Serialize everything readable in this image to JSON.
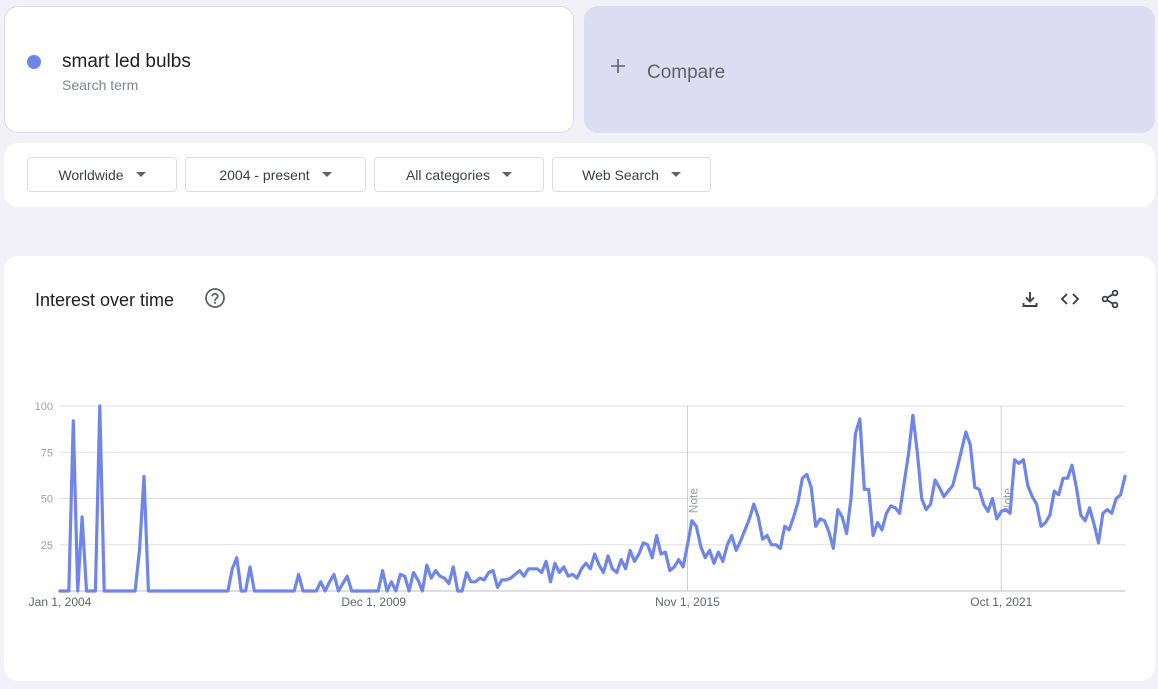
{
  "search_term": {
    "name": "smart led bulbs",
    "subtitle": "Search term",
    "color": "#6f86e8"
  },
  "compare": {
    "label": "Compare",
    "icon": "plus-icon"
  },
  "filters": [
    {
      "label": "Worldwide"
    },
    {
      "label": "2004 - present"
    },
    {
      "label": "All categories"
    },
    {
      "label": "Web Search"
    }
  ],
  "chart_card": {
    "title": "Interest over time",
    "icons": [
      "help-icon",
      "download-icon",
      "embed-icon",
      "share-icon"
    ]
  },
  "chart_data": {
    "type": "line",
    "title": "",
    "xlabel": "",
    "ylabel": "",
    "ylim": [
      0,
      100
    ],
    "yticks": [
      25,
      50,
      75,
      100
    ],
    "xtick_labels": [
      "Jan 1, 2004",
      "Dec 1, 2009",
      "Nov 1, 2015",
      "Oct 1, 2021"
    ],
    "x_start": "2004-01",
    "x_end": "2023-10",
    "annotations": [
      {
        "date": "2015-11",
        "label": "Note"
      },
      {
        "date": "2021-10",
        "label": "Note"
      }
    ],
    "grid": true,
    "series": [
      {
        "color": "#6f86e8",
        "points": [
          [
            "2004-01",
            0
          ],
          [
            "2004-03",
            0
          ],
          [
            "2004-04",
            92
          ],
          [
            "2004-05",
            0
          ],
          [
            "2004-06",
            40
          ],
          [
            "2004-07",
            0
          ],
          [
            "2004-09",
            0
          ],
          [
            "2004-10",
            100
          ],
          [
            "2004-11",
            0
          ],
          [
            "2005-06",
            0
          ],
          [
            "2005-07",
            22
          ],
          [
            "2005-08",
            62
          ],
          [
            "2005-09",
            0
          ],
          [
            "2007-03",
            0
          ],
          [
            "2007-04",
            12
          ],
          [
            "2007-05",
            18
          ],
          [
            "2007-06",
            0
          ],
          [
            "2007-07",
            0
          ],
          [
            "2007-08",
            13
          ],
          [
            "2007-09",
            0
          ],
          [
            "2008-06",
            0
          ],
          [
            "2008-07",
            9
          ],
          [
            "2008-08",
            0
          ],
          [
            "2008-11",
            0
          ],
          [
            "2008-12",
            5
          ],
          [
            "2009-01",
            0
          ],
          [
            "2009-02",
            5
          ],
          [
            "2009-03",
            9
          ],
          [
            "2009-04",
            0
          ],
          [
            "2009-06",
            8
          ],
          [
            "2009-07",
            0
          ],
          [
            "2010-01",
            0
          ],
          [
            "2010-02",
            11
          ],
          [
            "2010-03",
            0
          ],
          [
            "2010-04",
            5
          ],
          [
            "2010-05",
            0
          ],
          [
            "2010-06",
            9
          ],
          [
            "2010-07",
            8
          ],
          [
            "2010-08",
            0
          ],
          [
            "2010-09",
            10
          ],
          [
            "2010-10",
            6
          ],
          [
            "2010-11",
            0
          ],
          [
            "2010-12",
            14
          ],
          [
            "2011-01",
            7
          ],
          [
            "2011-02",
            11
          ],
          [
            "2011-03",
            8
          ],
          [
            "2011-04",
            7
          ],
          [
            "2011-05",
            4
          ],
          [
            "2011-06",
            13
          ],
          [
            "2011-07",
            0
          ],
          [
            "2011-08",
            0
          ],
          [
            "2011-09",
            10
          ],
          [
            "2011-10",
            5
          ],
          [
            "2011-11",
            5
          ],
          [
            "2011-12",
            7
          ],
          [
            "2012-01",
            6
          ],
          [
            "2012-02",
            10
          ],
          [
            "2012-03",
            11
          ],
          [
            "2012-04",
            2
          ],
          [
            "2012-05",
            6
          ],
          [
            "2012-06",
            6
          ],
          [
            "2012-07",
            7
          ],
          [
            "2012-08",
            9
          ],
          [
            "2012-09",
            11
          ],
          [
            "2012-10",
            8
          ],
          [
            "2012-11",
            12
          ],
          [
            "2012-12",
            12
          ],
          [
            "2013-01",
            12
          ],
          [
            "2013-02",
            10
          ],
          [
            "2013-03",
            16
          ],
          [
            "2013-04",
            5
          ],
          [
            "2013-05",
            15
          ],
          [
            "2013-06",
            10
          ],
          [
            "2013-07",
            13
          ],
          [
            "2013-08",
            8
          ],
          [
            "2013-09",
            9
          ],
          [
            "2013-10",
            7
          ],
          [
            "2013-11",
            12
          ],
          [
            "2013-12",
            15
          ],
          [
            "2014-01",
            12
          ],
          [
            "2014-02",
            20
          ],
          [
            "2014-03",
            14
          ],
          [
            "2014-04",
            10
          ],
          [
            "2014-05",
            19
          ],
          [
            "2014-06",
            12
          ],
          [
            "2014-07",
            10
          ],
          [
            "2014-08",
            17
          ],
          [
            "2014-09",
            12
          ],
          [
            "2014-10",
            22
          ],
          [
            "2014-11",
            16
          ],
          [
            "2014-12",
            20
          ],
          [
            "2015-01",
            26
          ],
          [
            "2015-02",
            25
          ],
          [
            "2015-03",
            18
          ],
          [
            "2015-04",
            30
          ],
          [
            "2015-05",
            20
          ],
          [
            "2015-06",
            21
          ],
          [
            "2015-07",
            11
          ],
          [
            "2015-08",
            13
          ],
          [
            "2015-09",
            17
          ],
          [
            "2015-10",
            13
          ],
          [
            "2015-11",
            25
          ],
          [
            "2015-12",
            38
          ],
          [
            "2016-01",
            35
          ],
          [
            "2016-02",
            24
          ],
          [
            "2016-03",
            18
          ],
          [
            "2016-04",
            22
          ],
          [
            "2016-05",
            15
          ],
          [
            "2016-06",
            21
          ],
          [
            "2016-07",
            16
          ],
          [
            "2016-08",
            25
          ],
          [
            "2016-09",
            30
          ],
          [
            "2016-10",
            22
          ],
          [
            "2016-11",
            27
          ],
          [
            "2016-12",
            33
          ],
          [
            "2017-01",
            39
          ],
          [
            "2017-02",
            47
          ],
          [
            "2017-03",
            40
          ],
          [
            "2017-04",
            28
          ],
          [
            "2017-05",
            30
          ],
          [
            "2017-06",
            25
          ],
          [
            "2017-07",
            25
          ],
          [
            "2017-08",
            23
          ],
          [
            "2017-09",
            35
          ],
          [
            "2017-10",
            33
          ],
          [
            "2017-11",
            40
          ],
          [
            "2017-12",
            48
          ],
          [
            "2018-01",
            61
          ],
          [
            "2018-02",
            63
          ],
          [
            "2018-03",
            56
          ],
          [
            "2018-04",
            35
          ],
          [
            "2018-05",
            39
          ],
          [
            "2018-06",
            38
          ],
          [
            "2018-07",
            32
          ],
          [
            "2018-08",
            23
          ],
          [
            "2018-09",
            44
          ],
          [
            "2018-10",
            40
          ],
          [
            "2018-11",
            31
          ],
          [
            "2018-12",
            50
          ],
          [
            "2019-01",
            85
          ],
          [
            "2019-02",
            93
          ],
          [
            "2019-03",
            55
          ],
          [
            "2019-04",
            55
          ],
          [
            "2019-05",
            30
          ],
          [
            "2019-06",
            37
          ],
          [
            "2019-07",
            33
          ],
          [
            "2019-08",
            42
          ],
          [
            "2019-09",
            46
          ],
          [
            "2019-10",
            45
          ],
          [
            "2019-11",
            42
          ],
          [
            "2019-12",
            58
          ],
          [
            "2020-01",
            74
          ],
          [
            "2020-02",
            95
          ],
          [
            "2020-03",
            75
          ],
          [
            "2020-04",
            50
          ],
          [
            "2020-05",
            44
          ],
          [
            "2020-06",
            47
          ],
          [
            "2020-07",
            60
          ],
          [
            "2020-08",
            56
          ],
          [
            "2020-09",
            51
          ],
          [
            "2020-10",
            54
          ],
          [
            "2020-11",
            57
          ],
          [
            "2020-12",
            66
          ],
          [
            "2021-01",
            76
          ],
          [
            "2021-02",
            86
          ],
          [
            "2021-03",
            79
          ],
          [
            "2021-04",
            56
          ],
          [
            "2021-05",
            55
          ],
          [
            "2021-06",
            47
          ],
          [
            "2021-07",
            43
          ],
          [
            "2021-08",
            50
          ],
          [
            "2021-09",
            39
          ],
          [
            "2021-10",
            43
          ],
          [
            "2021-11",
            44
          ],
          [
            "2021-12",
            42
          ],
          [
            "2022-01",
            71
          ],
          [
            "2022-02",
            69
          ],
          [
            "2022-03",
            71
          ],
          [
            "2022-04",
            57
          ],
          [
            "2022-05",
            51
          ],
          [
            "2022-06",
            47
          ],
          [
            "2022-07",
            35
          ],
          [
            "2022-08",
            37
          ],
          [
            "2022-09",
            41
          ],
          [
            "2022-10",
            54
          ],
          [
            "2022-11",
            52
          ],
          [
            "2022-12",
            61
          ],
          [
            "2023-01",
            61
          ],
          [
            "2023-02",
            68
          ],
          [
            "2023-03",
            56
          ],
          [
            "2023-04",
            41
          ],
          [
            "2023-05",
            38
          ],
          [
            "2023-06",
            45
          ],
          [
            "2023-07",
            36
          ],
          [
            "2023-08",
            26
          ],
          [
            "2023-09",
            42
          ],
          [
            "2023-10",
            44
          ],
          [
            "2023-11",
            42
          ],
          [
            "2023-12",
            50
          ],
          [
            "2024-01",
            52
          ],
          [
            "2024-02",
            62
          ]
        ]
      }
    ]
  }
}
